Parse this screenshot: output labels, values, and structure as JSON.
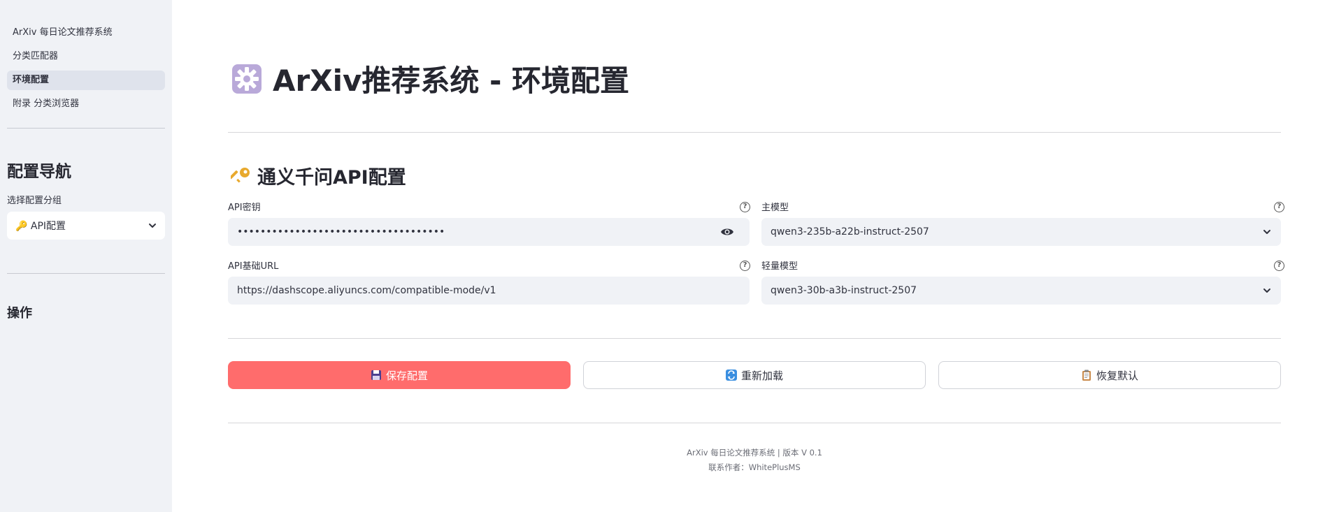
{
  "sidebar": {
    "nav_items": [
      {
        "label": "ArXiv 每日论文推荐系统",
        "active": false
      },
      {
        "label": "分类匹配器",
        "active": false
      },
      {
        "label": "环境配置",
        "active": true
      },
      {
        "label": "附录 分类浏览器",
        "active": false
      }
    ],
    "config_nav_heading": "配置导航",
    "select_label": "选择配置分组",
    "select_value": "🔑 API配置",
    "operations_heading": "操作"
  },
  "page": {
    "title": "ArXiv推荐系统 - 环境配置",
    "title_icon": "gear-icon"
  },
  "api_section": {
    "title": "通义千问API配置",
    "title_icon": "key-icon",
    "api_key": {
      "label": "API密钥",
      "value": "••••••••••••••••••••••••••••••••••••"
    },
    "main_model": {
      "label": "主模型",
      "value": "qwen3-235b-a22b-instruct-2507"
    },
    "api_base_url": {
      "label": "API基础URL",
      "value": "https://dashscope.aliyuncs.com/compatible-mode/v1"
    },
    "light_model": {
      "label": "轻量模型",
      "value": "qwen3-30b-a3b-instruct-2507"
    }
  },
  "actions": {
    "save_label": "保存配置",
    "reload_label": "重新加载",
    "reset_label": "恢复默认"
  },
  "footer": {
    "line1": "ArXiv 每日论文推荐系统 | 版本 V 0.1",
    "line2": "联系作者：WhitePlusMS"
  },
  "colors": {
    "sidebar_bg": "#f0f2f6",
    "primary_button": "#ff6c6c",
    "input_bg": "#f0f2f6"
  }
}
